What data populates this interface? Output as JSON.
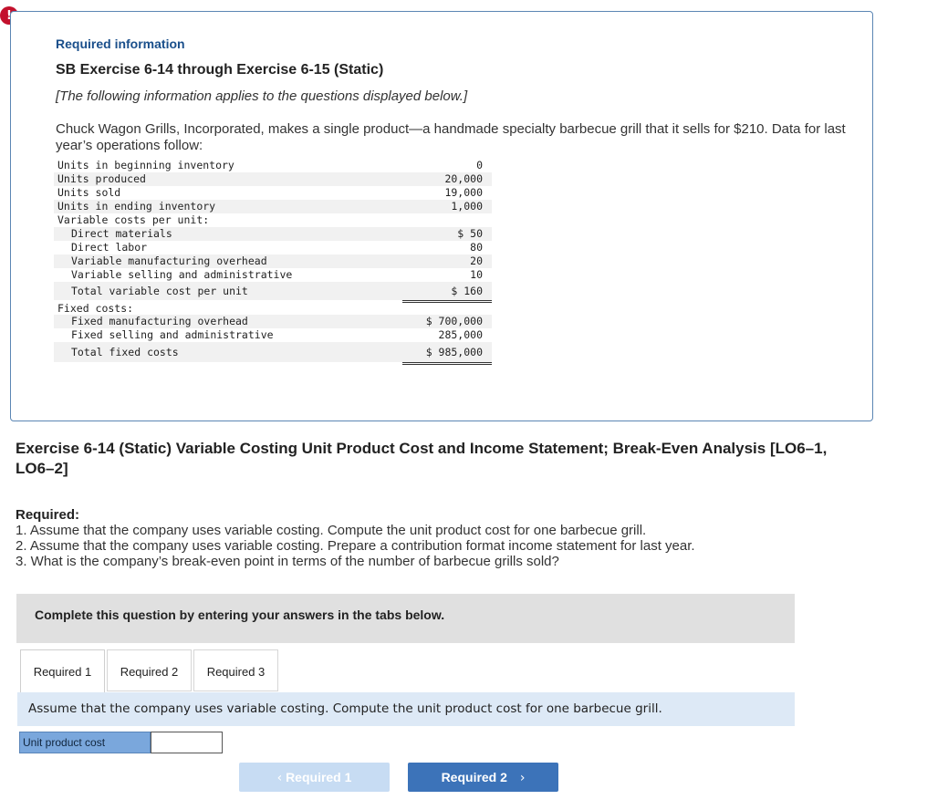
{
  "alert": {
    "glyph": "!"
  },
  "info": {
    "heading": "Required information",
    "title": "SB Exercise 6-14 through Exercise 6-15 (Static)",
    "note": "[The following information applies to the questions displayed below.]",
    "intro": "Chuck Wagon Grills, Incorporated, makes a single product—a handmade specialty barbecue grill that it sells for $210. Data for last year’s operations follow:"
  },
  "table": {
    "rows": [
      {
        "label": "Units in beginning inventory",
        "value": "0"
      },
      {
        "label": "Units produced",
        "value": "20,000"
      },
      {
        "label": "Units sold",
        "value": "19,000"
      },
      {
        "label": "Units in ending inventory",
        "value": "1,000"
      },
      {
        "label": "Variable costs per unit:",
        "value": ""
      },
      {
        "label": "Direct materials",
        "value": "$ 50"
      },
      {
        "label": "Direct labor",
        "value": "80"
      },
      {
        "label": "Variable manufacturing overhead",
        "value": "20"
      },
      {
        "label": "Variable selling and administrative",
        "value": "10"
      },
      {
        "label": "Total variable cost per unit",
        "value": "$ 160"
      },
      {
        "label": "Fixed costs:",
        "value": ""
      },
      {
        "label": "Fixed manufacturing overhead",
        "value": "$ 700,000"
      },
      {
        "label": "Fixed selling and administrative",
        "value": "285,000"
      },
      {
        "label": "Total fixed costs",
        "value": "$ 985,000"
      }
    ]
  },
  "exercise": {
    "title": "Exercise 6-14 (Static) Variable Costing Unit Product Cost and Income Statement; Break-Even Analysis [LO6–1, LO6–2]"
  },
  "required": {
    "heading": "Required:",
    "items": [
      "1. Assume that the company uses variable costing. Compute the unit product cost for one barbecue grill.",
      "2. Assume that the company uses variable costing. Prepare a contribution format income statement for last year.",
      "3. What is the company’s break-even point in terms of the number of barbecue grills sold?"
    ]
  },
  "complete_bar": "Complete this question by entering your answers in the tabs below.",
  "tabs": [
    {
      "label": "Required 1"
    },
    {
      "label": "Required 2"
    },
    {
      "label": "Required 3"
    }
  ],
  "instruction": "Assume that the company uses variable costing. Compute the unit product cost for one barbecue grill.",
  "answer": {
    "label": "Unit product cost",
    "value": ""
  },
  "nav": {
    "prev_label": "Required 1",
    "next_label": "Required 2",
    "prev_chevron": "‹",
    "next_chevron": "›"
  }
}
